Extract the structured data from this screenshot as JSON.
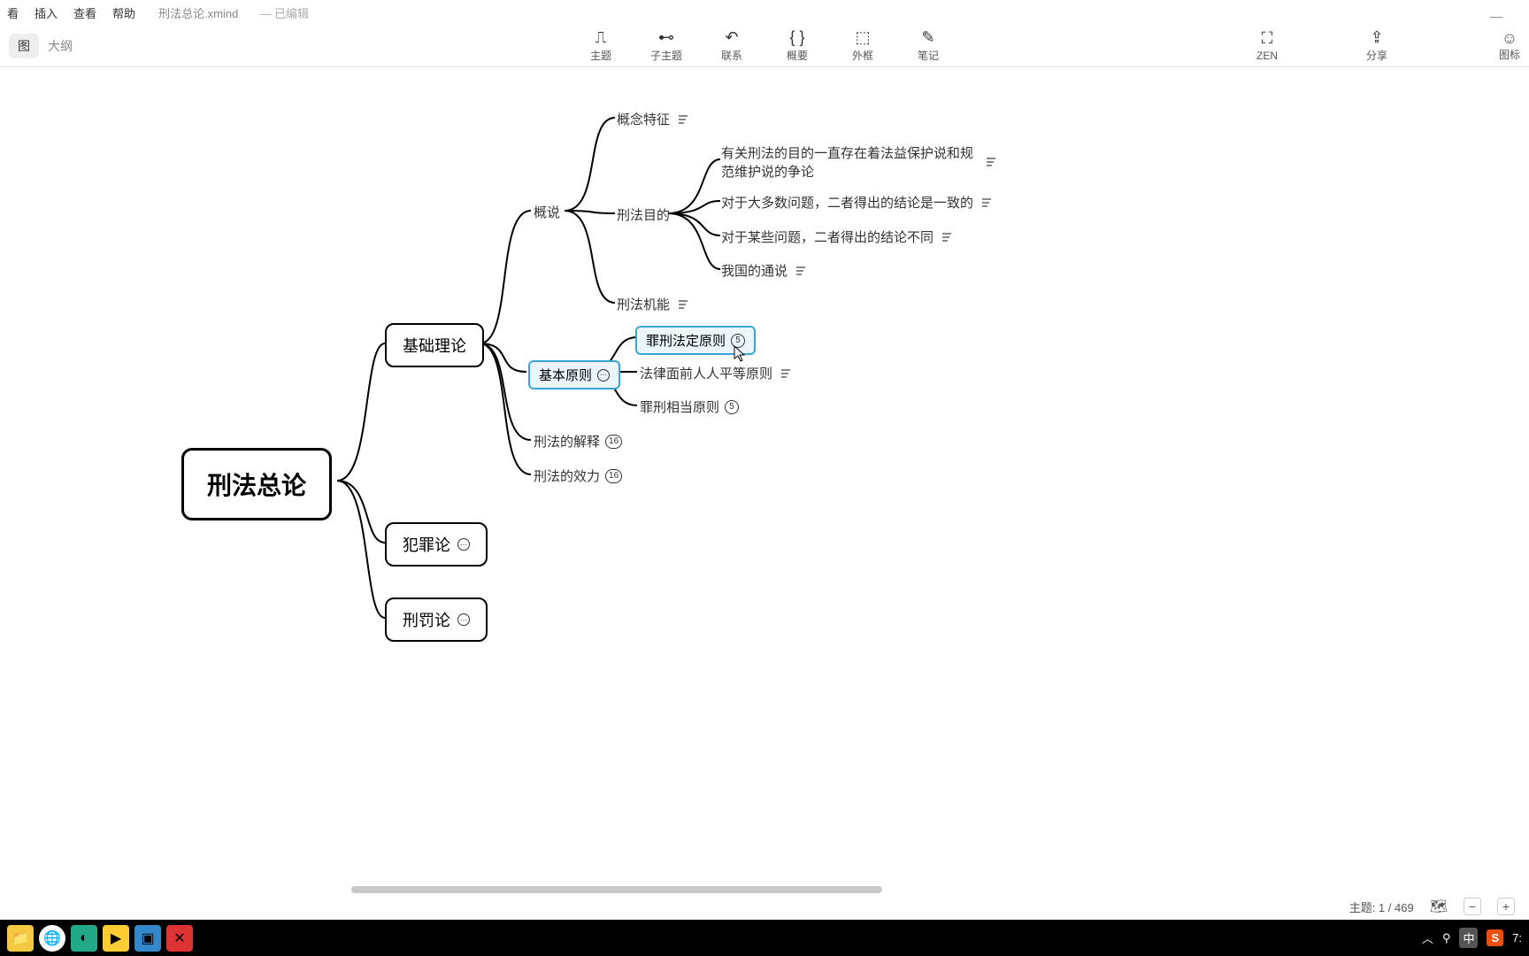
{
  "menubar": {
    "items": [
      "看",
      "插入",
      "查看",
      "帮助"
    ],
    "filename": "刑法总论.xmind",
    "modified": "— 已编辑"
  },
  "viewtabs": {
    "a": "图",
    "b": "大纲"
  },
  "toolbar": {
    "topic": "主题",
    "subtopic": "子主题",
    "relation": "联系",
    "summary": "概要",
    "boundary": "外框",
    "notes": "笔记",
    "zen": "ZEN",
    "share": "分享",
    "icons": "图标"
  },
  "mindmap": {
    "root": "刑法总论",
    "b1": "基础理论",
    "b2": "犯罪论",
    "b3": "刑罚论",
    "l1": "概说",
    "l2": "基本原则",
    "l3": "刑法的解释",
    "l3_count": "16",
    "l4": "刑法的效力",
    "l4_count": "16",
    "g1": "概念特征",
    "g2": "刑法目的",
    "g3": "刑法机能",
    "p1": "罪刑法定原则",
    "p1_count": "5",
    "p2": "法律面前人人平等原则",
    "p3": "罪刑相当原则",
    "p3_count": "5",
    "m1": "有关刑法的目的一直存在着法益保护说和规范维护说的争论",
    "m2": "对于大多数问题，二者得出的结论是一致的",
    "m3": "对于某些问题，二者得出的结论不同",
    "m4": "我国的通说"
  },
  "status": {
    "topic_count": "主题: 1 / 469"
  },
  "tray": {
    "ime": "中",
    "sogou": "S",
    "time": "7:"
  }
}
